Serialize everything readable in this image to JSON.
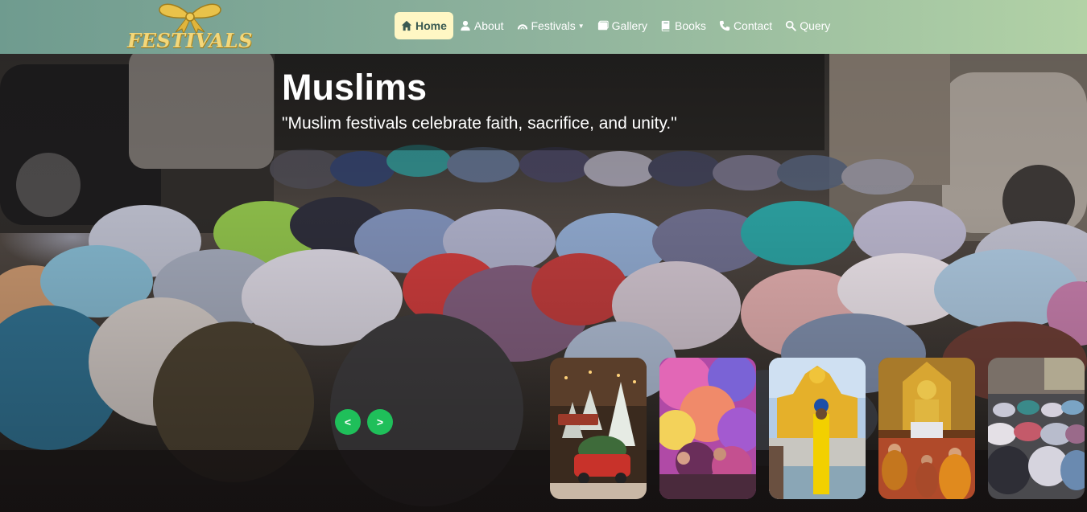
{
  "brand": {
    "name": "FESTIVALS"
  },
  "nav": {
    "items": [
      {
        "label": "Home",
        "icon": "home-icon",
        "active": true
      },
      {
        "label": "About",
        "icon": "user-icon",
        "active": false
      },
      {
        "label": "Festivals",
        "icon": "rainbow-icon",
        "active": false,
        "has_dropdown": true
      },
      {
        "label": "Gallery",
        "icon": "gallery-icon",
        "active": false
      },
      {
        "label": "Books",
        "icon": "book-icon",
        "active": false
      },
      {
        "label": "Contact",
        "icon": "phone-icon",
        "active": false
      },
      {
        "label": "Query",
        "icon": "search-icon",
        "active": false
      }
    ]
  },
  "slide": {
    "title": "Muslims",
    "quote": "\"Muslim festivals celebrate faith, sacrifice, and unity.\""
  },
  "controls": {
    "prev": "<",
    "next": ">"
  },
  "thumbnails": [
    {
      "name": "christmas-thumbnail"
    },
    {
      "name": "holi-thumbnail"
    },
    {
      "name": "golden-temple-thumbnail"
    },
    {
      "name": "buddhist-temple-thumbnail"
    },
    {
      "name": "muslim-prayer-thumbnail"
    }
  ],
  "colors": {
    "navbar_start": "#6f9b8f",
    "navbar_end": "#b2d2a6",
    "active_tab": "#fff7c4",
    "brand_gold": "#f3d77a",
    "control_green": "#1fbf5a"
  }
}
